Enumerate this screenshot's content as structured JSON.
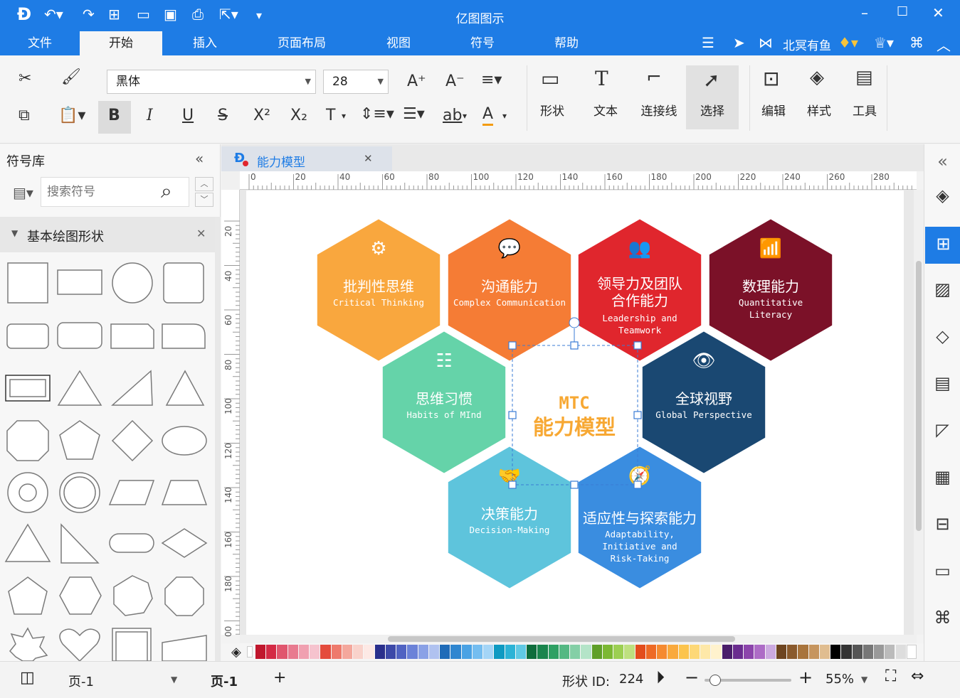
{
  "app": {
    "title": "亿图图示"
  },
  "quick_access": [
    "logo-icon",
    "undo-icon",
    "redo-icon",
    "new-icon",
    "open-icon",
    "save-icon",
    "print-icon",
    "export-icon",
    "customize-icon"
  ],
  "window_controls": [
    "minimize-icon",
    "maximize-icon",
    "close-icon"
  ],
  "menu": {
    "items": [
      "文件",
      "开始",
      "插入",
      "页面布局",
      "视图",
      "符号",
      "帮助"
    ],
    "active": "开始"
  },
  "account": {
    "user": "北冥有鱼"
  },
  "ribbon": {
    "font_name": "黑体",
    "font_size": "28",
    "big_buttons": [
      "形状",
      "文本",
      "连接线",
      "选择",
      "编辑",
      "样式",
      "工具"
    ],
    "format_buttons": {
      "bold": "B",
      "italic": "I",
      "underline": "U",
      "strike": "S",
      "superscript": "X²",
      "subscript": "X₂",
      "text": "T",
      "ab": "ab",
      "fontcolor": "A"
    }
  },
  "library": {
    "title": "符号库",
    "search_placeholder": "搜索符号",
    "category": "基本绘图形状"
  },
  "document": {
    "tab": "能力模型"
  },
  "rulers": {
    "h": [
      "0",
      "20",
      "40",
      "60",
      "80",
      "100",
      "120",
      "140",
      "160",
      "180",
      "200",
      "220",
      "240",
      "260",
      "280"
    ],
    "v": [
      "20",
      "40",
      "60",
      "80",
      "100",
      "120",
      "140",
      "160",
      "180",
      "00"
    ]
  },
  "diagram": {
    "center": {
      "line1": "MTC",
      "line2": "能力模型",
      "color": "#f7a833"
    },
    "hexes": [
      {
        "key": "critical",
        "title": "批判性思维",
        "subtitle": [
          "Critical  Thinking"
        ],
        "color": "#f9a73e",
        "icon": "gears-icon"
      },
      {
        "key": "communication",
        "title": "沟通能力",
        "subtitle": [
          "Complex  Communication"
        ],
        "color": "#f57c35",
        "icon": "chat-icon"
      },
      {
        "key": "leadership",
        "title": "领导力及团队",
        "title2": "合作能力",
        "subtitle": [
          "Leadership  and",
          "Teamwork"
        ],
        "color": "#e0262d",
        "icon": "team-icon"
      },
      {
        "key": "data",
        "title": "数理能力",
        "subtitle": [
          "Quantitative",
          "Literacy"
        ],
        "color": "#7b1128",
        "icon": "wifi-icon"
      },
      {
        "key": "habits",
        "title": "思维习惯",
        "subtitle": [
          "Habits  of  MInd"
        ],
        "color": "#65d3a9",
        "icon": "list-icon"
      },
      {
        "key": "global",
        "title": "全球视野",
        "subtitle": [
          "Global  Perspective"
        ],
        "color": "#1a4872",
        "icon": "eye-icon"
      },
      {
        "key": "decision",
        "title": "决策能力",
        "subtitle": [
          "Decision-Making"
        ],
        "color": "#5ec4dc",
        "icon": "handshake-icon"
      },
      {
        "key": "adapt",
        "title": "适应性与探索能力",
        "subtitle": [
          "Adaptability,",
          "Initiative  and",
          "Risk-Taking"
        ],
        "color": "#3a8de0",
        "icon": "compass-icon"
      }
    ]
  },
  "status": {
    "page_selector": "页-1",
    "page_tab": "页-1",
    "shape_id_label": "形状 ID:",
    "shape_id": "224",
    "zoom": "55%",
    "zoom_level": 0.12
  },
  "palette": [
    "#c0172d",
    "#d42a45",
    "#e0566e",
    "#e87a8f",
    "#f0a0b0",
    "#f6c3ce",
    "#e44b3c",
    "#ee7a6c",
    "#f4a79c",
    "#f9d2cb",
    "#fde9e5",
    "#2a2f8c",
    "#3c49a8",
    "#5063c2",
    "#6b82d8",
    "#8aa1e6",
    "#b0c2f0",
    "#1f6bb8",
    "#2f86d0",
    "#4aa2e4",
    "#74bdf0",
    "#a4d5f7",
    "#0e9ac2",
    "#2cb3d6",
    "#60c9e4",
    "#0e6d3c",
    "#19854d",
    "#2ea063",
    "#54b883",
    "#84cfa6",
    "#b4e4c8",
    "#5f9f28",
    "#7cb833",
    "#9ccf52",
    "#bee07f",
    "#e34d1c",
    "#ee6a25",
    "#f58a30",
    "#f9a93c",
    "#fcc44d",
    "#fdd877",
    "#fee8a8",
    "#fff2cd",
    "#4a1e6a",
    "#6a2c8f",
    "#8c45ab",
    "#ad6cc6",
    "#ccaae0",
    "#6e4520",
    "#8a5a2c",
    "#a8743c",
    "#c6955e",
    "#e0bd90",
    "#000000",
    "#333333",
    "#555555",
    "#777777",
    "#999999",
    "#bbbbbb",
    "#dddddd",
    "#ffffff"
  ]
}
